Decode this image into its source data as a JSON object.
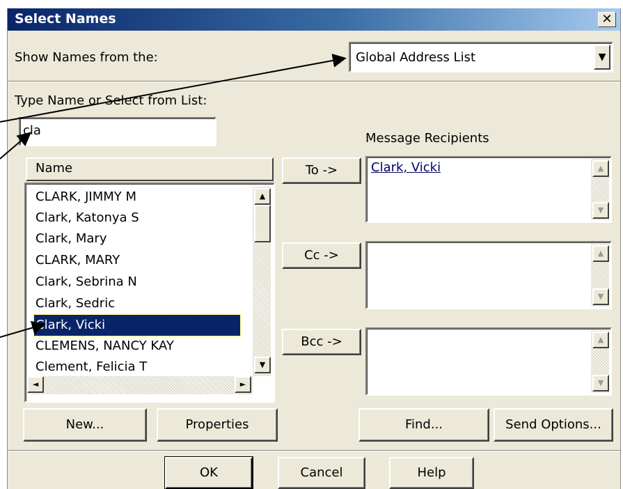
{
  "dialog": {
    "title": "Select Names",
    "close": "✕"
  },
  "show_names": {
    "label": "Show Names from the:",
    "value": "Global Address List",
    "arrow": "▼"
  },
  "type_name": {
    "label": "Type Name or Select from List:",
    "value": "cla"
  },
  "list": {
    "header": "Name",
    "items": [
      {
        "name": "CLARK, JIMMY M",
        "selected": false
      },
      {
        "name": "Clark, Katonya S",
        "selected": false
      },
      {
        "name": "Clark, Mary",
        "selected": false
      },
      {
        "name": "CLARK, MARY",
        "selected": false
      },
      {
        "name": "Clark, Sebrina N",
        "selected": false
      },
      {
        "name": "Clark, Sedric",
        "selected": false
      },
      {
        "name": "Clark, Vicki",
        "selected": true
      },
      {
        "name": "CLEMENS, NANCY KAY",
        "selected": false
      },
      {
        "name": "Clement, Felicia T",
        "selected": false
      }
    ]
  },
  "recipients": {
    "label": "Message Recipients",
    "to_button": "To ->",
    "cc_button": "Cc ->",
    "bcc_button": "Bcc ->",
    "to_value": "Clark, Vicki"
  },
  "scroll": {
    "up": "▲",
    "down": "▼",
    "left": "◄",
    "right": "►"
  },
  "buttons": {
    "new": "New...",
    "properties": "Properties",
    "find": "Find...",
    "send_options": "Send Options...",
    "ok": "OK",
    "cancel": "Cancel",
    "help": "Help"
  },
  "colors": {
    "title_start": "#0a246a",
    "selection": "#0a246a",
    "face": "#ece9d8"
  }
}
